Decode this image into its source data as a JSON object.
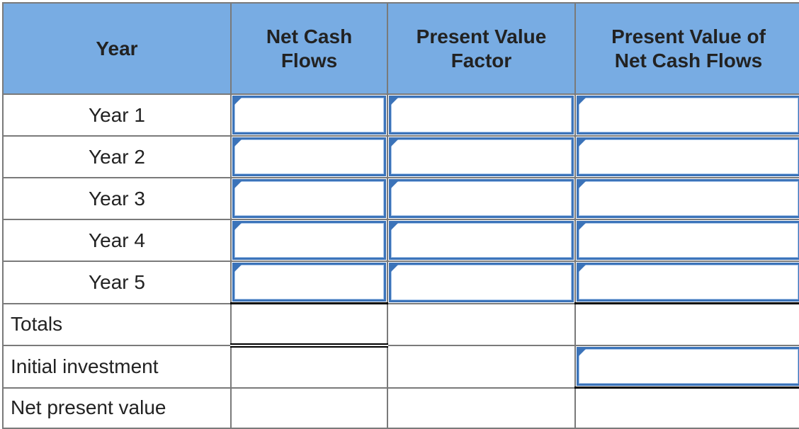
{
  "table": {
    "headers": [
      "Year",
      "Net Cash\nFlows",
      "Present Value\nFactor",
      "Present Value of\nNet Cash Flows"
    ],
    "header_lines": [
      [
        "Year"
      ],
      [
        "Net Cash",
        "Flows"
      ],
      [
        "Present Value",
        "Factor"
      ],
      [
        "Present Value of",
        "Net Cash Flows"
      ]
    ],
    "year_rows": [
      {
        "label": "Year 1",
        "net_cash_flows": "",
        "pv_factor": "",
        "pv_net_cash_flows": ""
      },
      {
        "label": "Year 2",
        "net_cash_flows": "",
        "pv_factor": "",
        "pv_net_cash_flows": ""
      },
      {
        "label": "Year 3",
        "net_cash_flows": "",
        "pv_factor": "",
        "pv_net_cash_flows": ""
      },
      {
        "label": "Year 4",
        "net_cash_flows": "",
        "pv_factor": "",
        "pv_net_cash_flows": ""
      },
      {
        "label": "Year 5",
        "net_cash_flows": "",
        "pv_factor": "",
        "pv_net_cash_flows": ""
      }
    ],
    "totals_label": "Totals",
    "initial_investment_label": "Initial investment",
    "initial_investment_value": "",
    "npv_label": "Net present value"
  },
  "colors": {
    "header_bg": "#78ace3",
    "input_border": "#3b73b9",
    "grid": "#7a7a7a"
  }
}
